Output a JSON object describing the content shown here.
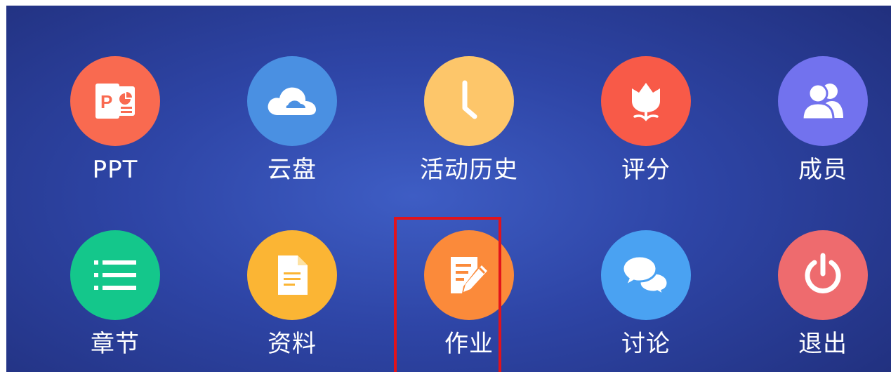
{
  "menu": {
    "items": [
      {
        "label": "PPT",
        "icon": "ppt-icon",
        "color": "#f96a50"
      },
      {
        "label": "云盘",
        "icon": "cloud-icon",
        "color": "#4a90e2"
      },
      {
        "label": "活动历史",
        "icon": "clock-icon",
        "color": "#fdc66a"
      },
      {
        "label": "评分",
        "icon": "lotus-icon",
        "color": "#f85a48"
      },
      {
        "label": "成员",
        "icon": "members-icon",
        "color": "#7272ee"
      },
      {
        "label": "章节",
        "icon": "list-icon",
        "color": "#14c78b"
      },
      {
        "label": "资料",
        "icon": "document-icon",
        "color": "#fbb534"
      },
      {
        "label": "作业",
        "icon": "edit-icon",
        "color": "#fb8a3a"
      },
      {
        "label": "讨论",
        "icon": "chat-icon",
        "color": "#4aa2f2"
      },
      {
        "label": "退出",
        "icon": "power-icon",
        "color": "#ee6b6e"
      }
    ]
  },
  "highlight": {
    "target": "作业",
    "color": "#e2131b"
  }
}
